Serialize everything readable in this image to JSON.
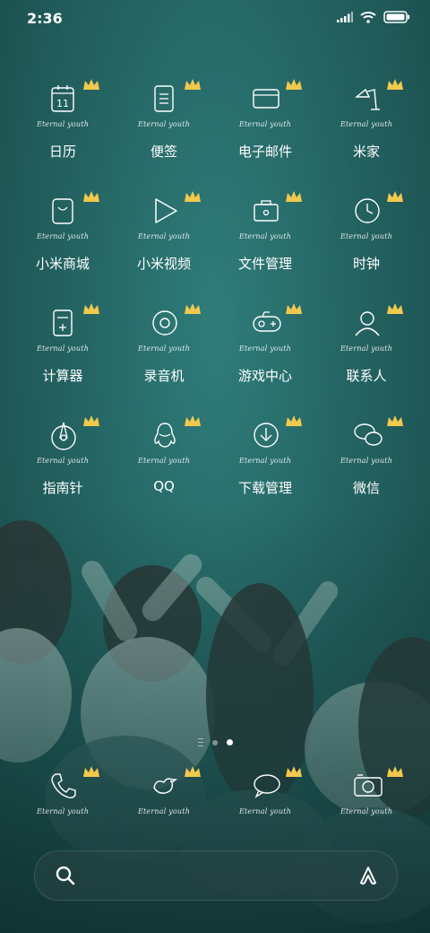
{
  "status_bar": {
    "time": "2:36"
  },
  "watermark": "Eternal youth",
  "apps": [
    {
      "label": "日历",
      "icon": "calendar-icon",
      "glyph_text": "11"
    },
    {
      "label": "便签",
      "icon": "notes-icon"
    },
    {
      "label": "电子邮件",
      "icon": "email-icon"
    },
    {
      "label": "米家",
      "icon": "mijia-lamp-icon"
    },
    {
      "label": "小米商城",
      "icon": "mi-store-icon"
    },
    {
      "label": "小米视频",
      "icon": "video-play-icon"
    },
    {
      "label": "文件管理",
      "icon": "file-manager-icon"
    },
    {
      "label": "时钟",
      "icon": "clock-icon"
    },
    {
      "label": "计算器",
      "icon": "calculator-icon"
    },
    {
      "label": "录音机",
      "icon": "recorder-icon"
    },
    {
      "label": "游戏中心",
      "icon": "gamepad-icon"
    },
    {
      "label": "联系人",
      "icon": "contacts-icon"
    },
    {
      "label": "指南针",
      "icon": "compass-icon"
    },
    {
      "label": "QQ",
      "icon": "qq-penguin-icon"
    },
    {
      "label": "下载管理",
      "icon": "download-icon"
    },
    {
      "label": "微信",
      "icon": "wechat-icon"
    }
  ],
  "dock": [
    {
      "icon": "phone-icon"
    },
    {
      "icon": "bird-icon"
    },
    {
      "icon": "message-bubble-icon"
    },
    {
      "icon": "camera-icon"
    }
  ],
  "page_indicator": {
    "pages": 3,
    "active": 2
  },
  "colors": {
    "background": "#225f5e",
    "crown": "#f2c94c",
    "text": "#ffffff"
  }
}
